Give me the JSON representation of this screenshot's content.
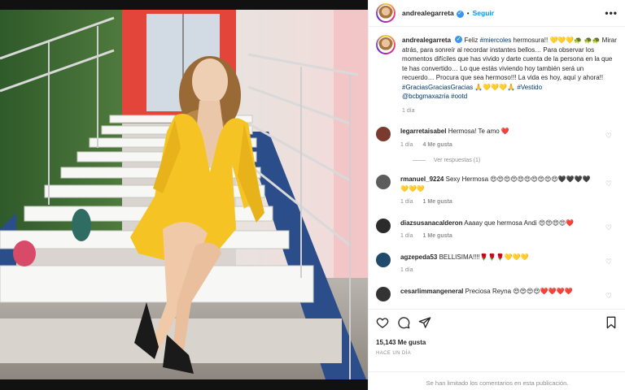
{
  "post": {
    "author": "andrealegarreta",
    "follow_label": "Seguir",
    "more_label": "•••"
  },
  "caption": {
    "username": "andrealegarreta",
    "text_1": "Feliz ",
    "tag_1": "#miercoles",
    "text_2": " hermosura!! 💛💛💛🐢",
    "text_3": "🐢🐢 Mirar atrás, para sonreír al recordar instantes bellos… Para observar los momentos difíciles que has vivido y darte cuenta de la persona en la que te has convertido… Lo que estás viviendo hoy también será un recuerdo… Procura que sea hermoso!!! La vida es hoy, aquí y ahora!! ",
    "tag_2": "#GraciasGraciasGracias",
    "text_4": " 🙏💛💛💛🙏 ",
    "tag_3": "#Vestido",
    "tag_4": "@bcbgmaxazria",
    "tag_5": "#ootd",
    "time": "1 día"
  },
  "comments": [
    {
      "username": "legarretaisabel",
      "text": "Hermosa! Te amo ❤️",
      "time": "1 día",
      "likes": "4 Me gusta",
      "avatar_color": "#7a3b2e"
    },
    {
      "username": "rmanuel_9224",
      "text": "Sexy Hermosa 😍😍😍😍😍😍😍😍😍😍🖤🖤🖤🖤💛💛💛",
      "time": "1 día",
      "likes": "1 Me gusta",
      "avatar_color": "#5c5c5c"
    },
    {
      "username": "diazsusanacalderon",
      "text": "Aaaay que hermosa Andi 😍😍😍😍❤️",
      "time": "1 día",
      "likes": "1 Me gusta",
      "avatar_color": "#2b2b2b"
    },
    {
      "username": "agzepeda53",
      "text": "BELLISIMA!!!!🌹🌹🌹💛💛💛",
      "time": "1 día",
      "likes": "",
      "avatar_color": "#1f4a6b"
    },
    {
      "username": "cesarlimmangeneral",
      "text": "Preciosa Reyna 😍😍😍😍❤️❤️❤️❤️",
      "time": "",
      "likes": "",
      "avatar_color": "#333333"
    }
  ],
  "replies_label": "Ver respuestas (1)",
  "footer": {
    "likes": "15,143 Me gusta",
    "date": "HACE UN DÍA",
    "limited": "Se han limitado los comentarios en esta publicación."
  },
  "colors": {
    "dress": "#f5c323",
    "link": "#00376b",
    "follow": "#0095f6"
  }
}
